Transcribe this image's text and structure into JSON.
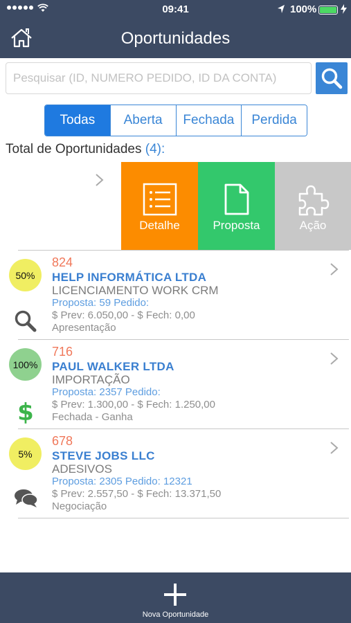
{
  "status_bar": {
    "time": "09:41",
    "battery": "100%"
  },
  "header": {
    "title": "Oportunidades"
  },
  "search": {
    "placeholder": "Pesquisar (ID, NUMERO PEDIDO, ID DA CONTA)",
    "value": ""
  },
  "filters": [
    {
      "label": "Todas",
      "active": true
    },
    {
      "label": "Aberta",
      "active": false
    },
    {
      "label": "Fechada",
      "active": false
    },
    {
      "label": "Perdida",
      "active": false
    }
  ],
  "summary": {
    "label": "Total de Oportunidades",
    "count": "(4):"
  },
  "swipe_actions": [
    {
      "label": "Detalhe",
      "color": "#fc8c00",
      "icon": "list-icon"
    },
    {
      "label": "Proposta",
      "color": "#33c86c",
      "icon": "document-icon"
    },
    {
      "label": "Ação",
      "color": "#c8c8c8",
      "icon": "puzzle-icon"
    }
  ],
  "opportunities": [
    {
      "percent": "50%",
      "badge_color": "#f0ee62",
      "id": "824",
      "company": "HELP INFORMÁTICA LTDA",
      "product": "LICENCIAMENTO WORK CRM",
      "proposal": "Proposta: 59 Pedido:",
      "values": "$ Prev: 6.050,00 - $ Fech: 0,00",
      "stage": "Apresentação",
      "status_icon": "search-icon"
    },
    {
      "percent": "100%",
      "badge_color": "#8fd18f",
      "id": "716",
      "company": "PAUL WALKER LTDA",
      "product": "IMPORTAÇÃO",
      "proposal": "Proposta: 2357 Pedido:",
      "values": "$ Prev: 1.300,00 - $ Fech: 1.250,00",
      "stage": "Fechada - Ganha",
      "status_icon": "dollar-icon"
    },
    {
      "percent": "5%",
      "badge_color": "#f0ee62",
      "id": "678",
      "company": "STEVE JOBS LLC",
      "product": "ADESIVOS",
      "proposal": "Proposta: 2305 Pedido: 12321",
      "values": "$ Prev: 2.557,50 - $ Fech: 13.371,50",
      "stage": "Negociação",
      "status_icon": "chat-bubbles-icon"
    }
  ],
  "tab_bar": {
    "add_label": "Nova Oportunidade"
  },
  "colors": {
    "navbar": "#3c4a63",
    "accent": "#3a86d6",
    "id_text": "#f0785a",
    "company_text": "#3a7fd0",
    "proposal_text": "#5d9de0"
  }
}
